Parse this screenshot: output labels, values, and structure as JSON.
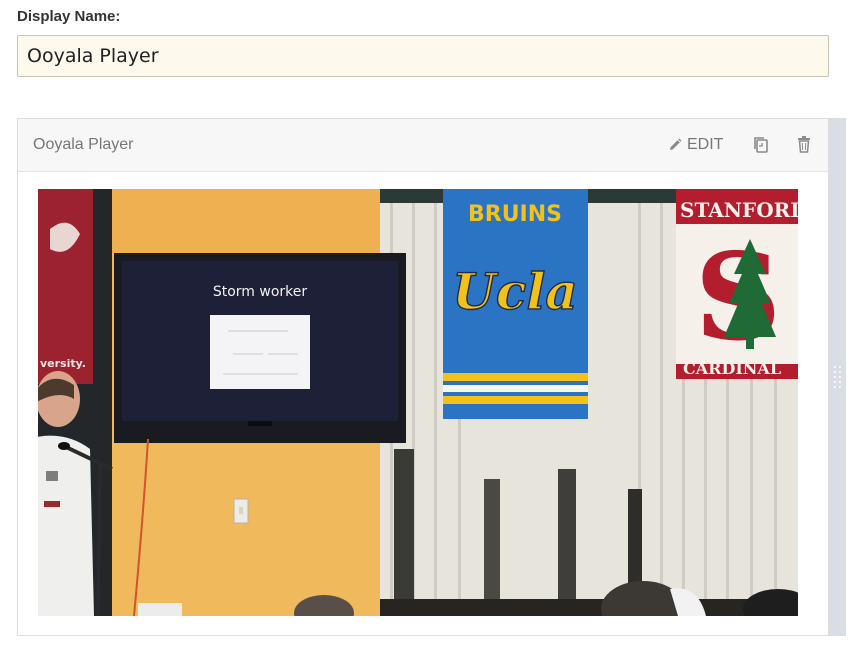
{
  "form": {
    "display_name_label": "Display Name:",
    "display_name_value": "Ooyala Player"
  },
  "component": {
    "title": "Ooyala Player",
    "edit_label": "EDIT",
    "icons": {
      "edit": "pencil-icon",
      "duplicate": "duplicate-icon",
      "delete": "trash-icon",
      "drag": "drag-handle-icon"
    }
  },
  "video": {
    "slide_title": "Storm worker",
    "banners": {
      "left_partial": "versity.",
      "ucla_top": "BRUINS",
      "ucla_script": "Ucla",
      "stanford_top": "STANFORD",
      "stanford_letter": "S",
      "stanford_bottom": "CARDINAL"
    }
  },
  "colors": {
    "input_bg": "#fdf9ec",
    "header_bg": "#f7f7f7",
    "rail": "#d9dde4",
    "wall_orange": "#f0b95c",
    "ucla_blue": "#2b74c4",
    "ucla_gold": "#f2c21b",
    "stanford_red": "#b41d2e"
  }
}
